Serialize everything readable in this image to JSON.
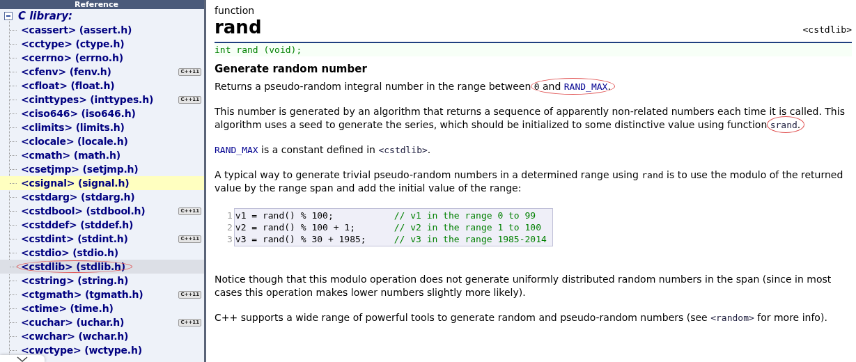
{
  "sidebar": {
    "header": "Reference",
    "section": {
      "label": "C library:",
      "expanded": true,
      "items": [
        {
          "label": "<cassert> (assert.h)",
          "selected": false,
          "hovered": false,
          "circled": false
        },
        {
          "label": "<cctype> (ctype.h)",
          "selected": false,
          "hovered": false,
          "circled": false
        },
        {
          "label": "<cerrno> (errno.h)",
          "selected": false,
          "hovered": false,
          "circled": false
        },
        {
          "label": "<cfenv> (fenv.h)",
          "selected": false,
          "hovered": false,
          "circled": false,
          "badge": "C++11"
        },
        {
          "label": "<cfloat> (float.h)",
          "selected": false,
          "hovered": false,
          "circled": false
        },
        {
          "label": "<cinttypes> (inttypes.h)",
          "selected": false,
          "hovered": false,
          "circled": false,
          "badge": "C++11"
        },
        {
          "label": "<ciso646> (iso646.h)",
          "selected": false,
          "hovered": false,
          "circled": false
        },
        {
          "label": "<climits> (limits.h)",
          "selected": false,
          "hovered": false,
          "circled": false
        },
        {
          "label": "<clocale> (locale.h)",
          "selected": false,
          "hovered": false,
          "circled": false
        },
        {
          "label": "<cmath> (math.h)",
          "selected": false,
          "hovered": false,
          "circled": false
        },
        {
          "label": "<csetjmp> (setjmp.h)",
          "selected": false,
          "hovered": false,
          "circled": false
        },
        {
          "label": "<csignal> (signal.h)",
          "selected": false,
          "hovered": true,
          "circled": false
        },
        {
          "label": "<cstdarg> (stdarg.h)",
          "selected": false,
          "hovered": false,
          "circled": false
        },
        {
          "label": "<cstdbool> (stdbool.h)",
          "selected": false,
          "hovered": false,
          "circled": false,
          "badge": "C++11"
        },
        {
          "label": "<cstddef> (stddef.h)",
          "selected": false,
          "hovered": false,
          "circled": false
        },
        {
          "label": "<cstdint> (stdint.h)",
          "selected": false,
          "hovered": false,
          "circled": false,
          "badge": "C++11"
        },
        {
          "label": "<cstdio> (stdio.h)",
          "selected": false,
          "hovered": false,
          "circled": false
        },
        {
          "label": "<cstdlib> (stdlib.h)",
          "selected": true,
          "hovered": false,
          "circled": true
        },
        {
          "label": "<cstring> (string.h)",
          "selected": false,
          "hovered": false,
          "circled": false
        },
        {
          "label": "<ctgmath> (tgmath.h)",
          "selected": false,
          "hovered": false,
          "circled": false,
          "badge": "C++11"
        },
        {
          "label": "<ctime> (time.h)",
          "selected": false,
          "hovered": false,
          "circled": false
        },
        {
          "label": "<cuchar> (uchar.h)",
          "selected": false,
          "hovered": false,
          "circled": false,
          "badge": "C++11"
        },
        {
          "label": "<cwchar> (wchar.h)",
          "selected": false,
          "hovered": false,
          "circled": false
        },
        {
          "label": "<cwctype> (wctype.h)",
          "selected": false,
          "hovered": false,
          "circled": false
        }
      ]
    }
  },
  "article": {
    "kind_label": "function",
    "title": "rand",
    "header_ref": "<cstdlib>",
    "prototype": "int rand (void);",
    "subtitle": "Generate random number",
    "blocks": [
      {
        "kind": "paragraph",
        "segments": [
          {
            "kind": "text",
            "text": "Returns a pseudo-random integral number in the range between "
          },
          {
            "kind": "circle",
            "parts": [
              {
                "kind": "code",
                "text": "0"
              },
              {
                "kind": "text",
                "text": " and "
              },
              {
                "kind": "link",
                "text": "RAND_MAX"
              },
              {
                "kind": "text",
                "text": "."
              }
            ]
          }
        ]
      },
      {
        "kind": "paragraph",
        "segments": [
          {
            "kind": "text",
            "text": "This number is generated by an algorithm that returns a sequence of apparently non-related numbers each time it is called. This algorithm uses a seed to generate the series, which should be initialized to some distinctive value using function "
          },
          {
            "kind": "circle",
            "parts": [
              {
                "kind": "ref",
                "text": "srand"
              },
              {
                "kind": "text",
                "text": "."
              }
            ]
          }
        ]
      },
      {
        "kind": "paragraph",
        "segments": [
          {
            "kind": "link",
            "text": "RAND_MAX"
          },
          {
            "kind": "text",
            "text": " is a constant defined in "
          },
          {
            "kind": "ref",
            "text": "<cstdlib>"
          },
          {
            "kind": "text",
            "text": "."
          }
        ]
      },
      {
        "kind": "paragraph",
        "segments": [
          {
            "kind": "text",
            "text": "A typical way to generate trivial pseudo-random numbers in a determined range using "
          },
          {
            "kind": "code",
            "text": "rand"
          },
          {
            "kind": "text",
            "text": " is to use the modulo of the returned value by the range span and add the initial value of the range:"
          }
        ]
      },
      {
        "kind": "code",
        "lines": [
          {
            "number": "1",
            "code": "v1 = rand() % 100;",
            "comment": "// v1 in the range 0 to 99"
          },
          {
            "number": "2",
            "code": "v2 = rand() % 100 + 1;",
            "comment": "// v2 in the range 1 to 100"
          },
          {
            "number": "3",
            "code": "v3 = rand() % 30 + 1985;",
            "comment": "// v3 in the range 1985-2014"
          }
        ]
      },
      {
        "kind": "paragraph",
        "segments": [
          {
            "kind": "text",
            "text": "Notice though that this modulo operation does not generate uniformly distributed random numbers in the span (since in most cases this operation makes lower numbers slightly more likely)."
          }
        ]
      },
      {
        "kind": "paragraph",
        "segments": [
          {
            "kind": "text",
            "text": "C++ supports a wide range of powerful tools to generate random and pseudo-random numbers (see "
          },
          {
            "kind": "ref",
            "text": "<random>"
          },
          {
            "kind": "text",
            "text": " for more info)."
          }
        ]
      }
    ]
  }
}
